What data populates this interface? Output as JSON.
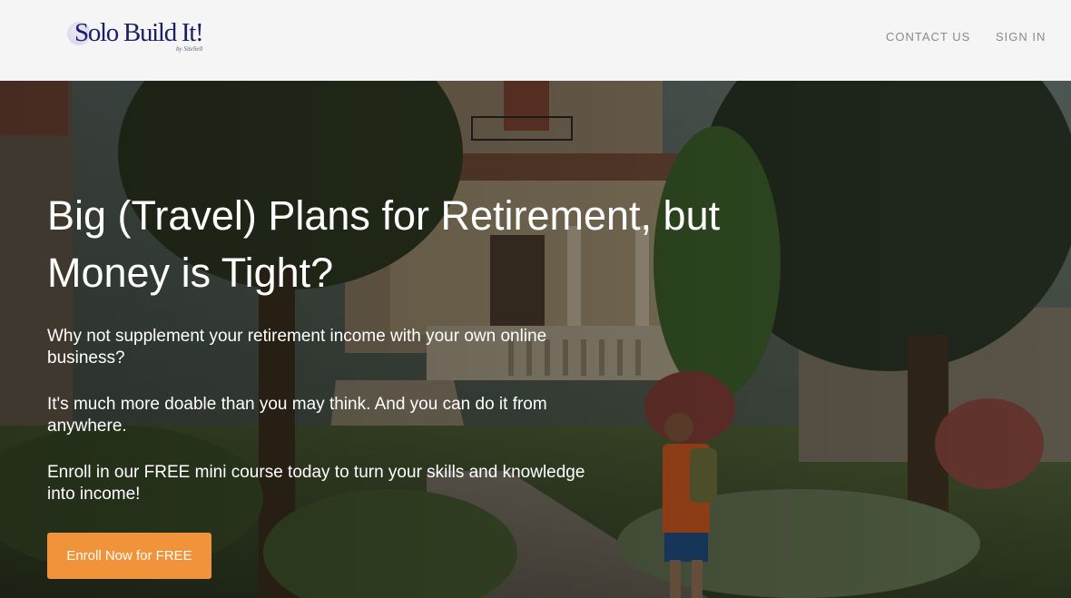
{
  "header": {
    "logo_text": "Solo Build It!",
    "logo_sub": "by SiteSell",
    "nav": {
      "contact_label": "CONTACT US",
      "signin_label": "SIGN IN"
    }
  },
  "hero": {
    "headline": "Big (Travel) Plans for Retirement, but Money is Tight?",
    "paragraphs": [
      "Why not supplement your retirement income with your own online business?",
      "It's much more doable than you may think. And you can do it from anywhere.",
      "Enroll in our FREE mini course today to turn your skills and knowledge into income!"
    ],
    "cta_label": "Enroll Now for FREE"
  },
  "colors": {
    "accent": "#f0933a",
    "logo": "#1b1f66",
    "header_bg": "#f5f5f5",
    "nav_text": "#8a8a8a"
  }
}
